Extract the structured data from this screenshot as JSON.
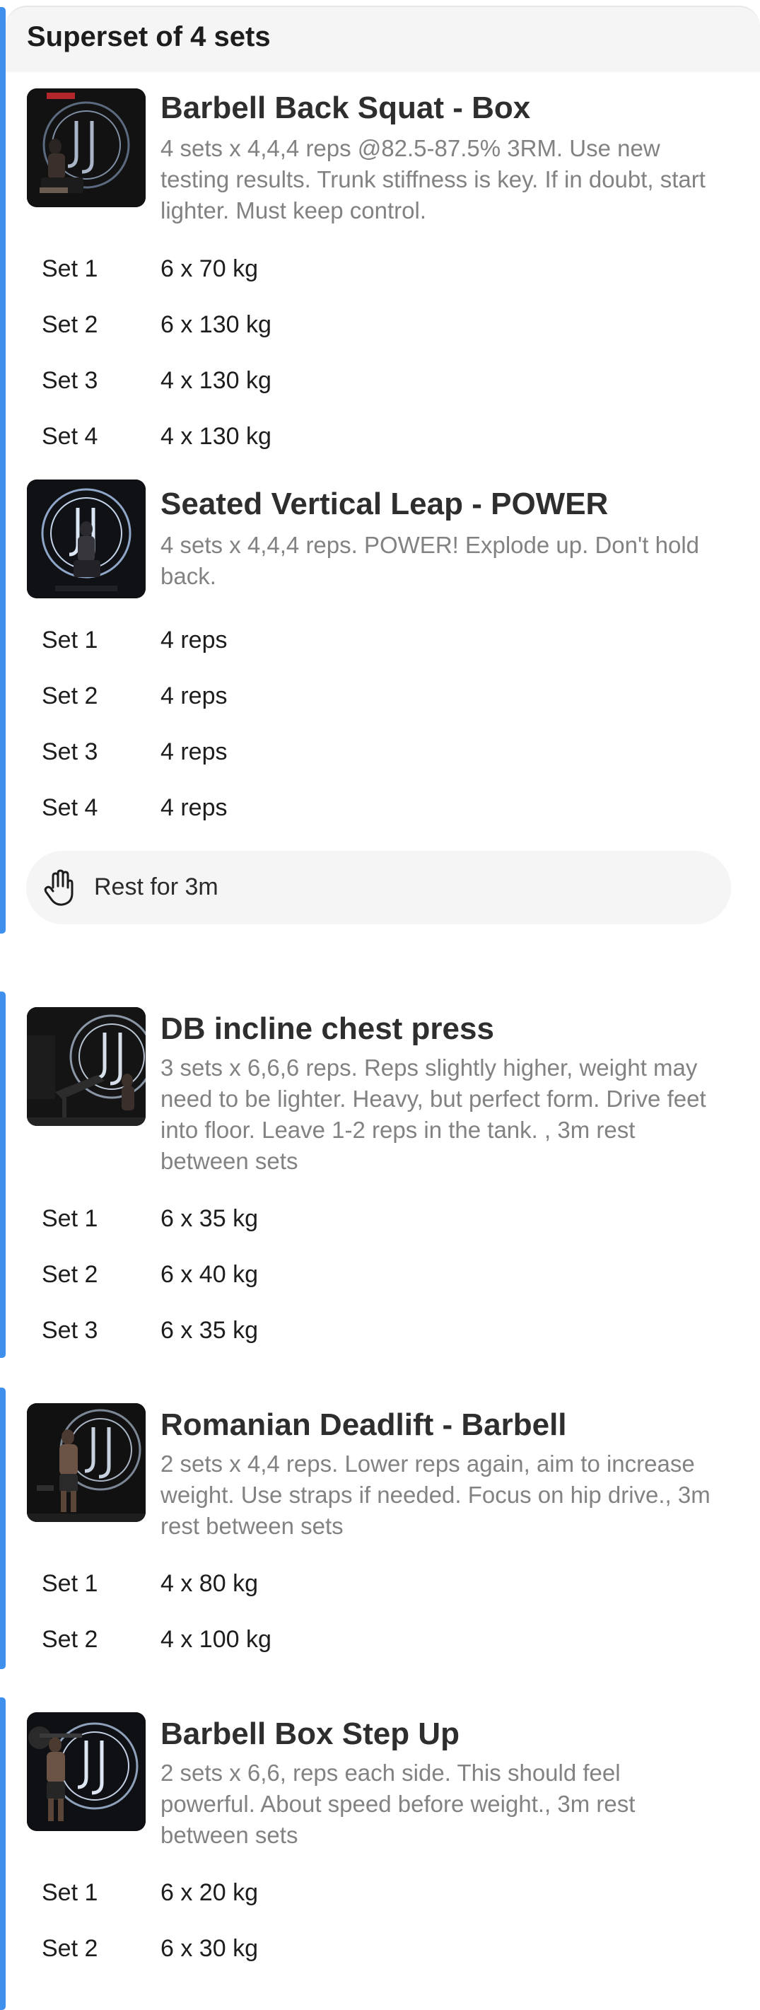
{
  "superset": {
    "title": "Superset of 4 sets",
    "rest_label": "Rest for 3m",
    "rest_icon": "hand-icon",
    "accent_color": "#3f8fec"
  },
  "exercises": [
    {
      "name": "Barbell Back Squat - Box",
      "description": "4 sets x 4,4,4 reps @82.5-87.5% 3RM. Use new testing results. Trunk stiffness is key. If in doubt, start lighter. Must keep control.",
      "sets": [
        {
          "label": "Set 1",
          "value": "6 x 70 kg"
        },
        {
          "label": "Set 2",
          "value": "6 x 130 kg"
        },
        {
          "label": "Set 3",
          "value": "4 x 130 kg"
        },
        {
          "label": "Set 4",
          "value": "4 x 130 kg"
        }
      ]
    },
    {
      "name": "Seated Vertical Leap - POWER",
      "description": "4 sets x 4,4,4 reps. POWER! Explode up. Don't hold back.",
      "sets": [
        {
          "label": "Set 1",
          "value": "4 reps"
        },
        {
          "label": "Set 2",
          "value": "4 reps"
        },
        {
          "label": "Set 3",
          "value": "4 reps"
        },
        {
          "label": "Set 4",
          "value": "4 reps"
        }
      ]
    },
    {
      "name": "DB incline chest press",
      "description": "3 sets x 6,6,6 reps. Reps slightly higher, weight may need to be lighter. Heavy, but perfect form. Drive feet into floor. Leave 1-2 reps in the tank.  , 3m rest between sets",
      "sets": [
        {
          "label": "Set 1",
          "value": "6 x 35 kg"
        },
        {
          "label": "Set 2",
          "value": "6 x 40 kg"
        },
        {
          "label": "Set 3",
          "value": "6 x 35 kg"
        }
      ]
    },
    {
      "name": "Romanian Deadlift - Barbell",
      "description": "2 sets x 4,4 reps. Lower reps again, aim to increase weight. Use straps if needed. Focus on hip drive., 3m rest between sets",
      "sets": [
        {
          "label": "Set 1",
          "value": "4 x 80 kg"
        },
        {
          "label": "Set 2",
          "value": "4 x 100 kg"
        }
      ]
    },
    {
      "name": "Barbell Box Step Up",
      "description": "2 sets x 6,6, reps each side. This should feel powerful. About speed before weight., 3m rest between sets",
      "sets": [
        {
          "label": "Set 1",
          "value": "6 x 20 kg"
        },
        {
          "label": "Set 2",
          "value": "6 x 30 kg"
        }
      ]
    }
  ]
}
